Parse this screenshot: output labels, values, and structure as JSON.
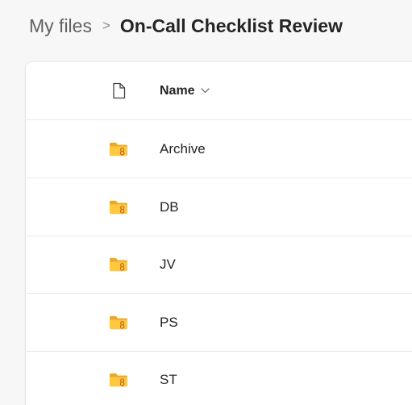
{
  "breadcrumb": {
    "root": "My files",
    "separator": ">",
    "current": "On-Call Checklist Review"
  },
  "file_list": {
    "header": {
      "type_icon": "file-icon",
      "name_label": "Name",
      "sort_icon": "chevron-down-icon"
    },
    "items": [
      {
        "name": "Archive",
        "icon": "shared-folder-icon"
      },
      {
        "name": "DB",
        "icon": "shared-folder-icon"
      },
      {
        "name": "JV",
        "icon": "shared-folder-icon"
      },
      {
        "name": "PS",
        "icon": "shared-folder-icon"
      },
      {
        "name": "ST",
        "icon": "shared-folder-icon"
      }
    ]
  },
  "colors": {
    "page_background": "#f7f7f7",
    "panel_background": "#ffffff",
    "folder_yellow": "#ffc83d",
    "folder_tab": "#e8a92e",
    "shared_badge": "#c76a1a",
    "text_primary": "#242424",
    "text_secondary": "#616161"
  }
}
